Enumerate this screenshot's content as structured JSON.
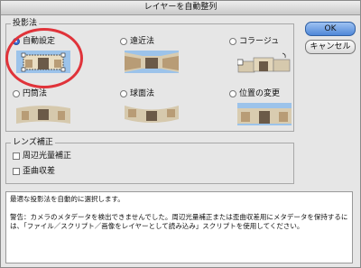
{
  "window": {
    "title": "レイヤーを自動整列"
  },
  "projection": {
    "label": "投影法",
    "options": [
      {
        "label": "自動設定",
        "selected": true
      },
      {
        "label": "遠近法",
        "selected": false
      },
      {
        "label": "コラージュ",
        "selected": false
      },
      {
        "label": "円筒法",
        "selected": false
      },
      {
        "label": "球面法",
        "selected": false
      },
      {
        "label": "位置の変更",
        "selected": false
      }
    ]
  },
  "lens": {
    "label": "レンズ補正",
    "vignette_label": "周辺光量補正",
    "distortion_label": "歪曲収差"
  },
  "buttons": {
    "ok": "OK",
    "cancel": "キャンセル"
  },
  "description": {
    "line1": "最適な投影法を自動的に選択します。",
    "line2": "警告：カメラのメタデータを検出できませんでした。周辺光量補正または歪曲収差用にメタデータを保持するには、「ファイル／スクリプト／画像をレイヤーとして読み込み」スクリプトを使用してください。"
  },
  "colors": {
    "highlight_circle": "#e0333a",
    "default_button": "#4f88d8"
  }
}
